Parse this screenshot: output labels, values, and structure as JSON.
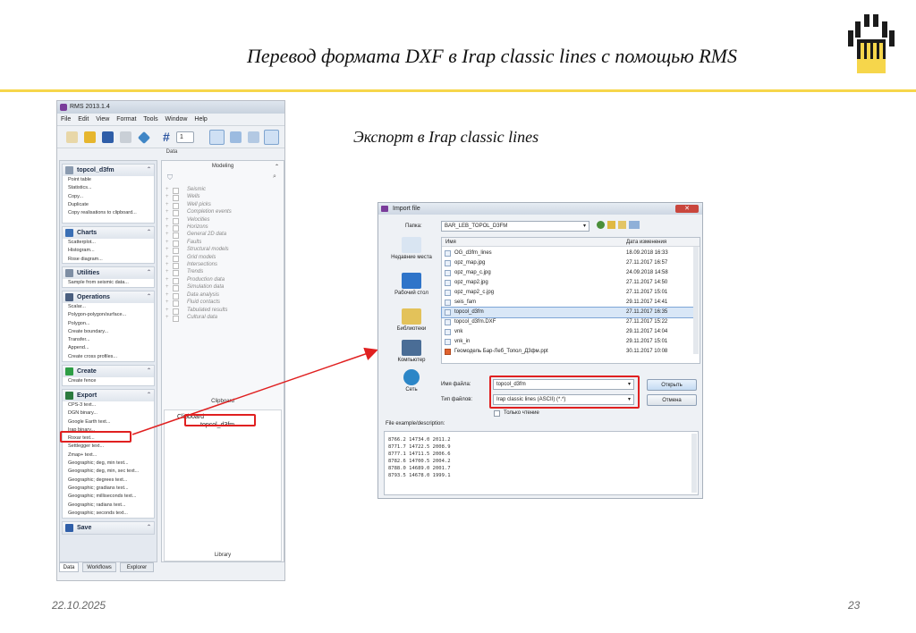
{
  "slide": {
    "title": "Перевод формата DXF в Irap classic lines с помощью RMS",
    "subtitle": "Экспорт в Irap classic lines",
    "date": "22.10.2025",
    "page": "23"
  },
  "rms": {
    "window_title": "RMS 2013.1.4",
    "menu": [
      "File",
      "Edit",
      "View",
      "Format",
      "Tools",
      "Window",
      "Help"
    ],
    "toolbar_value": "1",
    "data_header": "Data",
    "sections": {
      "object": {
        "title": "topcol_d3fm",
        "items": [
          "Point table",
          "Statistics...",
          "Copy...",
          "Duplicate",
          "Copy realisations to clipboard..."
        ]
      },
      "charts": {
        "title": "Charts",
        "items": [
          "Scatterplot...",
          "Histogram...",
          "Rose diagram..."
        ]
      },
      "utilities": {
        "title": "Utilities",
        "items": [
          "Sample from seismic data..."
        ]
      },
      "operations": {
        "title": "Operations",
        "items": [
          "Scalar...",
          "Polygon-polygon/surface...",
          "Polygon...",
          "Create boundary...",
          "Transfer...",
          "Append...",
          "Create cross profiles..."
        ]
      },
      "create": {
        "title": "Create",
        "items": [
          "Create fence"
        ]
      },
      "export": {
        "title": "Export",
        "items": [
          "CPS-3 text...",
          "DGN binary...",
          "Google Earth text...",
          "Irap binary...",
          "Roxar text...",
          "Settlegger text...",
          "Zmap+ text...",
          "Geographic; deg, min text...",
          "Geographic; deg, min, sec text...",
          "Geographic; degrees text...",
          "Geographic; gradians text...",
          "Geographic; milliseconds text...",
          "Geographic; radians text...",
          "Geographic; seconds text..."
        ]
      },
      "save": {
        "title": "Save"
      }
    },
    "modeling_header": "Modeling",
    "modeling_tree": [
      "Seismic",
      "Wells",
      "Well picks",
      "Completion events",
      "Velocities",
      "Horizons",
      "General 2D data",
      "Faults",
      "Structural models",
      "Grid models",
      "Intersections",
      "Trends",
      "Production data",
      "Simulation data",
      "Data analysis",
      "Fluid contacts",
      "Tabulated results",
      "Cultural data"
    ],
    "clipboard_header": "Clipboard",
    "clipboard_root": "Clipboard",
    "clipboard_item": "topcol_d3fm",
    "library_header": "Library",
    "tabs": [
      "Data",
      "Workflows",
      "Explorer"
    ]
  },
  "dialog": {
    "title": "Import file",
    "folder_label": "Папка:",
    "folder_value": "BAR_LEB_TOPOL_D3FM",
    "places": [
      "Недавние места",
      "Рабочий стол",
      "Библиотеки",
      "Компьютер",
      "Сеть"
    ],
    "col_name": "Имя",
    "col_date": "Дата изменения",
    "files": [
      {
        "name": "OG_d3fm_lines",
        "date": "18.09.2018 16:33"
      },
      {
        "name": "opz_map.jpg",
        "date": "27.11.2017 16:57"
      },
      {
        "name": "opz_map_c.jpg",
        "date": "24.09.2018 14:58"
      },
      {
        "name": "opz_map2.jpg",
        "date": "27.11.2017 14:50"
      },
      {
        "name": "opz_map2_c.jpg",
        "date": "27.11.2017 15:01"
      },
      {
        "name": "seis_fam",
        "date": "29.11.2017 14:41"
      },
      {
        "name": "topcol_d3fm",
        "date": "27.11.2017 16:35"
      },
      {
        "name": "topcol_d3fm.DXF",
        "date": "27.11.2017 15:22"
      },
      {
        "name": "vnk",
        "date": "29.11.2017 14:04"
      },
      {
        "name": "vnk_in",
        "date": "29.11.2017 15:01"
      },
      {
        "name": "Геомодель Бар-Леб_Топол_Д3фм.ppt",
        "date": "30.11.2017 10:08"
      }
    ],
    "filename_label": "Имя файла:",
    "filename_value": "topcol_d3fm",
    "filetype_label": "Тип файлов:",
    "filetype_value": "Irap classic lines (ASCII) (*.*)",
    "open_button": "Открыть",
    "cancel_button": "Отмена",
    "readonly_label": "Только чтение",
    "preview_label": "File example/description:",
    "preview_lines": [
      "8766.2  14734.0  2011.2",
      "8771.7  14722.5  2008.9",
      "8777.1  14711.5  2006.6",
      "8782.6  14700.5  2004.2",
      "8788.0  14689.0  2001.7",
      "8793.5  14678.0  1999.1"
    ]
  },
  "colors": {
    "accent_yellow": "#f6d64b",
    "highlight_red": "#e02020",
    "logo_black": "#1b1b1b"
  }
}
